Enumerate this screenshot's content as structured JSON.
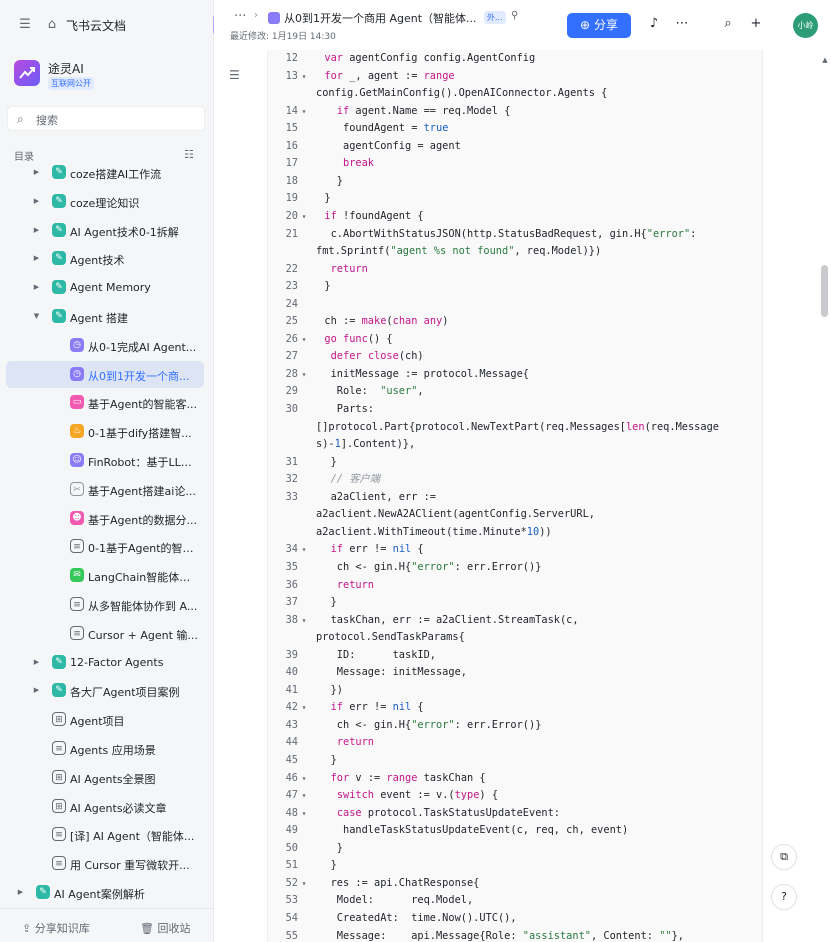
{
  "sidebar": {
    "brand": "飞书云文档",
    "space": {
      "name": "途灵AI",
      "tag": "互联网公开"
    },
    "search_placeholder": "搜索",
    "toc_label": "目录",
    "items": [
      {
        "label": "coze搭建AI工作流",
        "icon": "wiki",
        "color": "#2eb8a6",
        "arrow": "right"
      },
      {
        "label": "coze理论知识",
        "icon": "wiki",
        "color": "#2eb8a6",
        "arrow": "right"
      },
      {
        "label": "AI Agent技术0-1拆解",
        "icon": "wiki",
        "color": "#2eb8a6",
        "arrow": "right"
      },
      {
        "label": "Agent技术",
        "icon": "wiki",
        "color": "#2eb8a6",
        "arrow": "right"
      },
      {
        "label": "Agent Memory",
        "icon": "wiki",
        "color": "#2eb8a6",
        "arrow": "right"
      },
      {
        "label": "Agent 搭建",
        "icon": "wiki",
        "color": "#2eb8a6",
        "arrow": "down"
      },
      {
        "label": "从0-1完成AI Agent...",
        "icon": "timer",
        "color": "#8a7cf5",
        "arrow": ""
      },
      {
        "label": "从0到1开发一个商...",
        "icon": "timer",
        "color": "#8a7cf5",
        "arrow": "",
        "active": true
      },
      {
        "label": "基于Agent的智能客...",
        "icon": "card",
        "color": "#f05ab0",
        "arrow": ""
      },
      {
        "label": "0-1基于dify搭建智...",
        "icon": "fire",
        "color": "#f5a623",
        "arrow": ""
      },
      {
        "label": "FinRobot：基于LLM...",
        "icon": "robot",
        "color": "#8a7cf5",
        "arrow": ""
      },
      {
        "label": "基于Agent搭建ai论...",
        "icon": "tools",
        "color": "#8f959e",
        "arrow": ""
      },
      {
        "label": "基于Agent的数据分...",
        "icon": "smile",
        "color": "#f05ab0",
        "arrow": ""
      },
      {
        "label": "0-1基于Agent的智能...",
        "icon": "doc",
        "color": "#646a73",
        "arrow": ""
      },
      {
        "label": "LangChain智能体开...",
        "icon": "chat",
        "color": "#34c759",
        "arrow": ""
      },
      {
        "label": "从多智能体协作到 A...",
        "icon": "doc",
        "color": "#646a73",
        "arrow": ""
      },
      {
        "label": "Cursor + Agent 输...",
        "icon": "doc",
        "color": "#646a73",
        "arrow": ""
      },
      {
        "label": "12-Factor Agents",
        "icon": "wiki",
        "color": "#2eb8a6",
        "arrow": "right"
      },
      {
        "label": "各大厂Agent项目案例",
        "icon": "wiki",
        "color": "#2eb8a6",
        "arrow": "right"
      },
      {
        "label": "Agent项目",
        "icon": "sheet",
        "color": "#646a73",
        "arrow": ""
      },
      {
        "label": "Agents 应用场景",
        "icon": "doc",
        "color": "#646a73",
        "arrow": ""
      },
      {
        "label": "AI Agents全景图",
        "icon": "sheet",
        "color": "#646a73",
        "arrow": ""
      },
      {
        "label": "AI Agents必读文章",
        "icon": "sheet",
        "color": "#646a73",
        "arrow": ""
      },
      {
        "label": "[译] AI Agent（智能体...",
        "icon": "doc",
        "color": "#646a73",
        "arrow": ""
      },
      {
        "label": "用 Cursor 重写微软开...",
        "icon": "doc",
        "color": "#646a73",
        "arrow": ""
      },
      {
        "label": "AI Agent案例解析",
        "icon": "wiki",
        "color": "#2eb8a6",
        "arrow": "right"
      }
    ],
    "footer": {
      "share": "分享知识库",
      "trash": "回收站"
    }
  },
  "topbar": {
    "more": "···",
    "doc_title": "从0到1开发一个商用 Agent（智能体...",
    "ext_tag": "外...",
    "last_modified": "最近修改: 1月19日 14:30",
    "share_label": "分享",
    "avatar_text": "小岭"
  },
  "code": [
    {
      "n": "12",
      "t": [
        [
          "  "
        ],
        [
          "var",
          "k"
        ],
        [
          " agentConfig config.AgentConfig"
        ]
      ]
    },
    {
      "n": "13",
      "a": "▾",
      "t": [
        [
          "  "
        ],
        [
          "for",
          "k"
        ],
        [
          " _, agent := "
        ],
        [
          "range",
          "k"
        ]
      ]
    },
    {
      "n": "",
      "t": [
        [
          "config.GetMainConfig().OpenAIConnector.Agents {"
        ]
      ]
    },
    {
      "n": "14",
      "a": "▾",
      "t": [
        [
          "    "
        ],
        [
          "if",
          "k"
        ],
        [
          " agent.Name == req.Model {"
        ]
      ]
    },
    {
      "n": "15",
      "t": [
        [
          "     foundAgent = "
        ],
        [
          "true",
          "b"
        ]
      ]
    },
    {
      "n": "16",
      "t": [
        [
          "     agentConfig = agent"
        ]
      ]
    },
    {
      "n": "17",
      "t": [
        [
          "     "
        ],
        [
          "break",
          "k"
        ]
      ]
    },
    {
      "n": "18",
      "t": [
        [
          "    }"
        ]
      ]
    },
    {
      "n": "19",
      "t": [
        [
          "  }"
        ]
      ]
    },
    {
      "n": "20",
      "a": "▾",
      "t": [
        [
          "  "
        ],
        [
          "if",
          "k"
        ],
        [
          " !foundAgent {"
        ]
      ]
    },
    {
      "n": "21",
      "t": [
        [
          "   c.AbortWithStatusJSON(http.StatusBadRequest, gin.H{"
        ],
        [
          "\"error\"",
          "s"
        ],
        [
          ":"
        ]
      ]
    },
    {
      "n": "",
      "t": [
        [
          "fmt.Sprintf("
        ],
        [
          "\"agent %s not found\"",
          "s"
        ],
        [
          ", req.Model)})"
        ]
      ]
    },
    {
      "n": "22",
      "t": [
        [
          "   "
        ],
        [
          "return",
          "k"
        ]
      ]
    },
    {
      "n": "23",
      "t": [
        [
          "  }"
        ]
      ]
    },
    {
      "n": "24",
      "t": [
        [
          ""
        ]
      ]
    },
    {
      "n": "25",
      "t": [
        [
          "  ch := "
        ],
        [
          "make",
          "k"
        ],
        [
          "("
        ],
        [
          "chan",
          "k"
        ],
        [
          " "
        ],
        [
          "any",
          "k"
        ],
        [
          ")"
        ]
      ]
    },
    {
      "n": "26",
      "a": "▾",
      "t": [
        [
          "  "
        ],
        [
          "go",
          "k"
        ],
        [
          " "
        ],
        [
          "func",
          "k"
        ],
        [
          "() {"
        ]
      ]
    },
    {
      "n": "27",
      "t": [
        [
          "   "
        ],
        [
          "defer",
          "k"
        ],
        [
          " "
        ],
        [
          "close",
          "k"
        ],
        [
          "(ch)"
        ]
      ]
    },
    {
      "n": "28",
      "a": "▾",
      "t": [
        [
          "   initMessage := protocol.Message{"
        ]
      ]
    },
    {
      "n": "29",
      "t": [
        [
          "    Role:  "
        ],
        [
          "\"user\"",
          "s"
        ],
        [
          ","
        ]
      ]
    },
    {
      "n": "30",
      "t": [
        [
          "    Parts:"
        ]
      ]
    },
    {
      "n": "",
      "t": [
        [
          "[]protocol.Part{protocol.NewTextPart(req.Messages["
        ],
        [
          "len",
          "k"
        ],
        [
          "(req.Message"
        ]
      ]
    },
    {
      "n": "",
      "t": [
        [
          "s)-"
        ],
        [
          "1",
          "n"
        ],
        [
          "].Content)},"
        ]
      ]
    },
    {
      "n": "31",
      "t": [
        [
          "   }"
        ]
      ]
    },
    {
      "n": "32",
      "t": [
        [
          "   "
        ],
        [
          "// 客户端",
          "c"
        ]
      ]
    },
    {
      "n": "33",
      "t": [
        [
          "   a2aClient, err :="
        ]
      ]
    },
    {
      "n": "",
      "t": [
        [
          "a2aclient.NewA2AClient(agentConfig.ServerURL,"
        ]
      ]
    },
    {
      "n": "",
      "t": [
        [
          "a2aclient.WithTimeout(time.Minute*"
        ],
        [
          "10",
          "n"
        ],
        [
          "))"
        ]
      ]
    },
    {
      "n": "34",
      "a": "▾",
      "t": [
        [
          "   "
        ],
        [
          "if",
          "k"
        ],
        [
          " err != "
        ],
        [
          "nil",
          "b"
        ],
        [
          " {"
        ]
      ]
    },
    {
      "n": "35",
      "t": [
        [
          "    ch <- gin.H{"
        ],
        [
          "\"error\"",
          "s"
        ],
        [
          ": err.Error()}"
        ]
      ]
    },
    {
      "n": "36",
      "t": [
        [
          "    "
        ],
        [
          "return",
          "k"
        ]
      ]
    },
    {
      "n": "37",
      "t": [
        [
          "   }"
        ]
      ]
    },
    {
      "n": "38",
      "a": "▾",
      "t": [
        [
          "   taskChan, err := a2aClient.StreamTask(c,"
        ]
      ]
    },
    {
      "n": "",
      "t": [
        [
          "protocol.SendTaskParams{"
        ]
      ]
    },
    {
      "n": "39",
      "t": [
        [
          "    ID:      taskID,"
        ]
      ]
    },
    {
      "n": "40",
      "t": [
        [
          "    Message: initMessage,"
        ]
      ]
    },
    {
      "n": "41",
      "t": [
        [
          "   })"
        ]
      ]
    },
    {
      "n": "42",
      "a": "▾",
      "t": [
        [
          "   "
        ],
        [
          "if",
          "k"
        ],
        [
          " err != "
        ],
        [
          "nil",
          "b"
        ],
        [
          " {"
        ]
      ]
    },
    {
      "n": "43",
      "t": [
        [
          "    ch <- gin.H{"
        ],
        [
          "\"error\"",
          "s"
        ],
        [
          ": err.Error()}"
        ]
      ]
    },
    {
      "n": "44",
      "t": [
        [
          "    "
        ],
        [
          "return",
          "k"
        ]
      ]
    },
    {
      "n": "45",
      "t": [
        [
          "   }"
        ]
      ]
    },
    {
      "n": "46",
      "a": "▾",
      "t": [
        [
          "   "
        ],
        [
          "for",
          "k"
        ],
        [
          " v := "
        ],
        [
          "range",
          "k"
        ],
        [
          " taskChan {"
        ]
      ]
    },
    {
      "n": "47",
      "a": "▾",
      "t": [
        [
          "    "
        ],
        [
          "switch",
          "k"
        ],
        [
          " event := v.("
        ],
        [
          "type",
          "k"
        ],
        [
          ") {"
        ]
      ]
    },
    {
      "n": "48",
      "a": "▾",
      "t": [
        [
          "    "
        ],
        [
          "case",
          "k"
        ],
        [
          " protocol.TaskStatusUpdateEvent:"
        ]
      ]
    },
    {
      "n": "49",
      "t": [
        [
          "     handleTaskStatusUpdateEvent(c, req, ch, event)"
        ]
      ]
    },
    {
      "n": "50",
      "t": [
        [
          "    }"
        ]
      ]
    },
    {
      "n": "51",
      "t": [
        [
          "   }"
        ]
      ]
    },
    {
      "n": "52",
      "a": "▾",
      "t": [
        [
          "   res := api.ChatResponse{"
        ]
      ]
    },
    {
      "n": "53",
      "t": [
        [
          "    Model:      req.Model,"
        ]
      ]
    },
    {
      "n": "54",
      "t": [
        [
          "    CreatedAt:  time.Now().UTC(),"
        ]
      ]
    },
    {
      "n": "55",
      "t": [
        [
          "    Message:    api.Message{Role: "
        ],
        [
          "\"assistant\"",
          "s"
        ],
        [
          ", Content: "
        ],
        [
          "\"\"",
          "s"
        ],
        [
          "},"
        ]
      ]
    }
  ]
}
